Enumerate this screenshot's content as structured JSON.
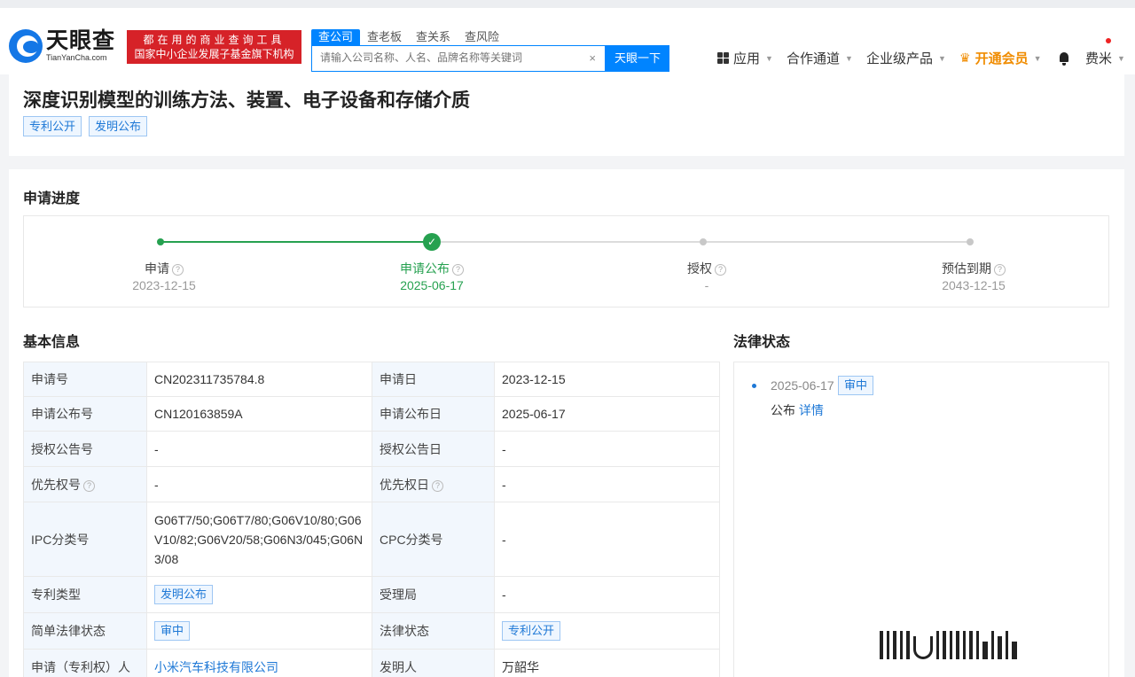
{
  "header": {
    "logo_cn": "天眼查",
    "logo_en": "TianYanCha.com",
    "slogan_line1": "都在用的商业查询工具",
    "slogan_line2": "国家中小企业发展子基金旗下机构",
    "search_tabs": [
      "查公司",
      "查老板",
      "查关系",
      "查风险"
    ],
    "search_placeholder": "请输入公司名称、人名、品牌名称等关键词",
    "search_button": "天眼一下",
    "nav": {
      "apps": "应用",
      "cooperation": "合作通道",
      "enterprise": "企业级产品",
      "vip": "开通会员",
      "user": "费米"
    }
  },
  "patent": {
    "title": "深度识别模型的训练方法、装置、电子设备和存储介质",
    "tags": [
      "专利公开",
      "发明公布"
    ]
  },
  "progress": {
    "section_title": "申请进度",
    "steps": [
      {
        "label": "申请",
        "date": "2023-12-15",
        "state": "done"
      },
      {
        "label": "申请公布",
        "date": "2025-06-17",
        "state": "current"
      },
      {
        "label": "授权",
        "date": "-",
        "state": "pending"
      },
      {
        "label": "预估到期",
        "date": "2043-12-15",
        "state": "pending"
      }
    ]
  },
  "basic_info": {
    "section_title": "基本信息",
    "rows": [
      {
        "k1": "申请号",
        "v1": "CN202311735784.8",
        "k2": "申请日",
        "v2": "2023-12-15"
      },
      {
        "k1": "申请公布号",
        "v1": "CN120163859A",
        "k2": "申请公布日",
        "v2": "2025-06-17"
      },
      {
        "k1": "授权公告号",
        "v1": "-",
        "k2": "授权公告日",
        "v2": "-"
      },
      {
        "k1": "优先权号",
        "v1": "-",
        "k2": "优先权日",
        "v2": "-"
      },
      {
        "k1": "IPC分类号",
        "v1": "G06T7/50;G06T7/80;G06V10/80;G06V10/82;G06V20/58;G06N3/045;G06N3/08",
        "k2": "CPC分类号",
        "v2": "-"
      },
      {
        "k1": "专利类型",
        "v1": "发明公布",
        "k2": "受理局",
        "v2": "-"
      },
      {
        "k1": "简单法律状态",
        "v1": "审中",
        "k2": "法律状态",
        "v2": "专利公开"
      },
      {
        "k1": "申请（专利权）人",
        "v1": "小米汽车科技有限公司",
        "k2": "发明人",
        "v2": "万韶华"
      }
    ]
  },
  "legal_status": {
    "section_title": "法律状态",
    "date": "2025-06-17",
    "tag": "审中",
    "desc": "公布",
    "detail_link": "详情"
  }
}
